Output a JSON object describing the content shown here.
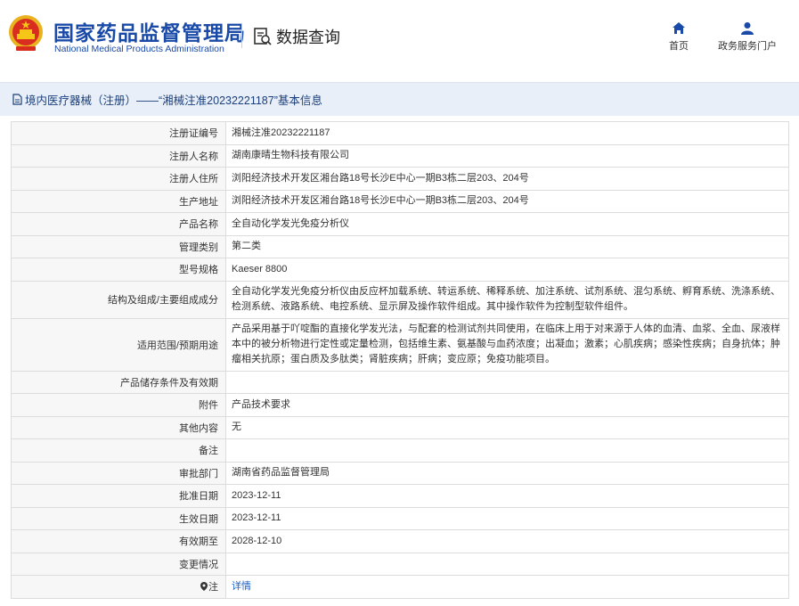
{
  "header": {
    "org_cn": "国家药品监督管理局",
    "org_en": "National Medical Products Administration",
    "query_label": "数据查询",
    "nav": [
      {
        "label": "首页",
        "icon": "home-icon"
      },
      {
        "label": "政务服务门户",
        "icon": "user-icon"
      }
    ]
  },
  "breadcrumb": "境内医疗器械（注册）——“湘械注准20232221187”基本信息",
  "colors": {
    "brand": "#1a4aa8",
    "link": "#1a5fc7",
    "subbar_bg": "#e9eff8",
    "label_bg": "#f7f7f7"
  },
  "rows": [
    {
      "label": "注册证编号",
      "value": "湘械注准20232221187"
    },
    {
      "label": "注册人名称",
      "value": "湖南康晴生物科技有限公司"
    },
    {
      "label": "注册人住所",
      "value": "浏阳经济技术开发区湘台路18号长沙E中心一期B3栋二层203、204号"
    },
    {
      "label": "生产地址",
      "value": "浏阳经济技术开发区湘台路18号长沙E中心一期B3栋二层203、204号"
    },
    {
      "label": "产品名称",
      "value": "全自动化学发光免疫分析仪"
    },
    {
      "label": "管理类别",
      "value": "第二类"
    },
    {
      "label": "型号规格",
      "value": "Kaeser 8800"
    },
    {
      "label": "结构及组成/主要组成成分",
      "value": "全自动化学发光免疫分析仪由反应杯加载系统、转运系统、稀释系统、加注系统、试剂系统、混匀系统、孵育系统、洗涤系统、检测系统、液路系统、电控系统、显示屏及操作软件组成。其中操作软件为控制型软件组件。"
    },
    {
      "label": "适用范围/预期用途",
      "value": "产品采用基于吖啶酯的直接化学发光法，与配套的检测试剂共同使用，在临床上用于对来源于人体的血清、血浆、全血、尿液样本中的被分析物进行定性或定量检测，包括维生素、氨基酸与血药浓度；出凝血；激素；心肌疾病；感染性疾病；自身抗体；肿瘤相关抗原；蛋白质及多肽类；肾脏疾病；肝病；变应原；免疫功能项目。"
    },
    {
      "label": "产品储存条件及有效期",
      "value": ""
    },
    {
      "label": "附件",
      "value": "产品技术要求"
    },
    {
      "label": "其他内容",
      "value": "无"
    },
    {
      "label": "备注",
      "value": ""
    },
    {
      "label": "审批部门",
      "value": "湖南省药品监督管理局"
    },
    {
      "label": "批准日期",
      "value": "2023-12-11"
    },
    {
      "label": "生效日期",
      "value": "2023-12-11"
    },
    {
      "label": "有效期至",
      "value": "2028-12-10"
    },
    {
      "label": "变更情况",
      "value": ""
    },
    {
      "label": "注",
      "value": "详情"
    }
  ]
}
